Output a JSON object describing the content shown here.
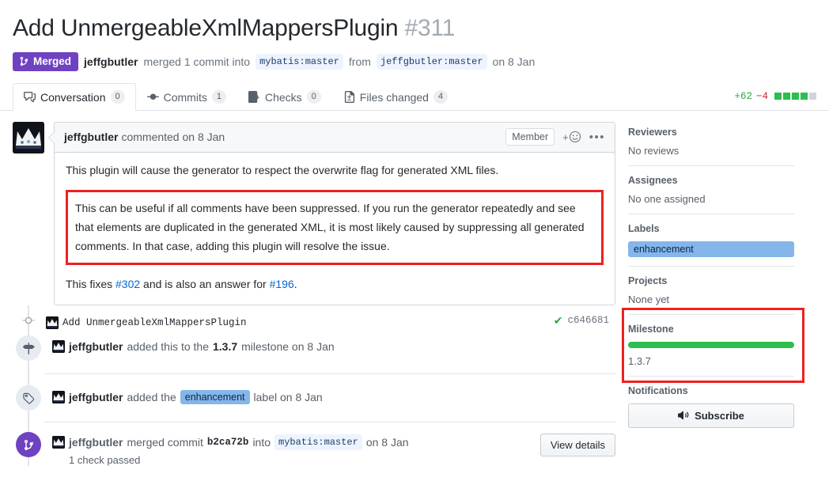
{
  "header": {
    "title": "Add UnmergeableXmlMappersPlugin",
    "number": "#311",
    "state": "Merged",
    "state_icon": "git-merge-icon",
    "author": "jeffgbutler",
    "merged_text": "merged 1 commit into",
    "base_branch": "mybatis:master",
    "from_text": "from",
    "head_branch": "jeffgbutler:master",
    "date": "on 8 Jan"
  },
  "tabs": [
    {
      "label": "Conversation",
      "count": "0",
      "icon": "comment-discussion-icon",
      "active": true
    },
    {
      "label": "Commits",
      "count": "1",
      "icon": "git-commit-icon",
      "active": false
    },
    {
      "label": "Checks",
      "count": "0",
      "icon": "checklist-icon",
      "active": false
    },
    {
      "label": "Files changed",
      "count": "4",
      "icon": "file-diff-icon",
      "active": false
    }
  ],
  "diffstat": {
    "additions": "+62",
    "deletions": "−4",
    "green_blocks": 4,
    "neutral_blocks": 1
  },
  "comment": {
    "author": "jeffgbutler",
    "action": "commented on 8 Jan",
    "badge": "Member",
    "paragraph1": "This plugin will cause the generator to respect the overwrite flag for generated XML files.",
    "highlighted_paragraph": "This can be useful if all comments have been suppressed. If you run the generator repeatedly and see that elements are duplicated in the generated XML, it is most likely caused by suppressing all generated comments. In that case, adding this plugin will resolve the issue.",
    "fixes_prefix": "This fixes ",
    "fixes_link": "#302",
    "fixes_middle": " and is also an answer for ",
    "answer_link": "#196",
    "fixes_suffix": "."
  },
  "timeline": {
    "commit": {
      "message": "Add UnmergeableXmlMappersPlugin",
      "sha": "c646681",
      "status_icon": "check-icon"
    },
    "milestone_event": {
      "actor": "jeffgbutler",
      "text_before": "added this to the",
      "milestone": "1.3.7",
      "text_after": "milestone on 8 Jan",
      "icon": "milestone-icon"
    },
    "label_event": {
      "actor": "jeffgbutler",
      "text_before": "added the",
      "label": "enhancement",
      "text_after": "label on 8 Jan",
      "icon": "tag-icon"
    },
    "merge_event": {
      "actor": "jeffgbutler",
      "text_before": "merged commit",
      "sha": "b2ca72b",
      "text_into": "into",
      "branch": "mybatis:master",
      "date": "on 8 Jan",
      "checks": "1 check passed",
      "button": "View details",
      "icon": "git-merge-icon"
    }
  },
  "sidebar": {
    "reviewers": {
      "title": "Reviewers",
      "value": "No reviews"
    },
    "assignees": {
      "title": "Assignees",
      "value": "No one assigned"
    },
    "labels": {
      "title": "Labels",
      "chip": "enhancement"
    },
    "projects": {
      "title": "Projects",
      "value": "None yet"
    },
    "milestone": {
      "title": "Milestone",
      "value": "1.3.7",
      "progress_percent": 100
    },
    "notifications": {
      "title": "Notifications",
      "button": "Subscribe",
      "button_icon": "mute-icon"
    }
  },
  "colors": {
    "merged_purple": "#6f42c1",
    "label_blue": "#84b6eb",
    "green": "#2cbe4e",
    "annotation_red": "#f02020",
    "link_blue": "#0366d6"
  }
}
